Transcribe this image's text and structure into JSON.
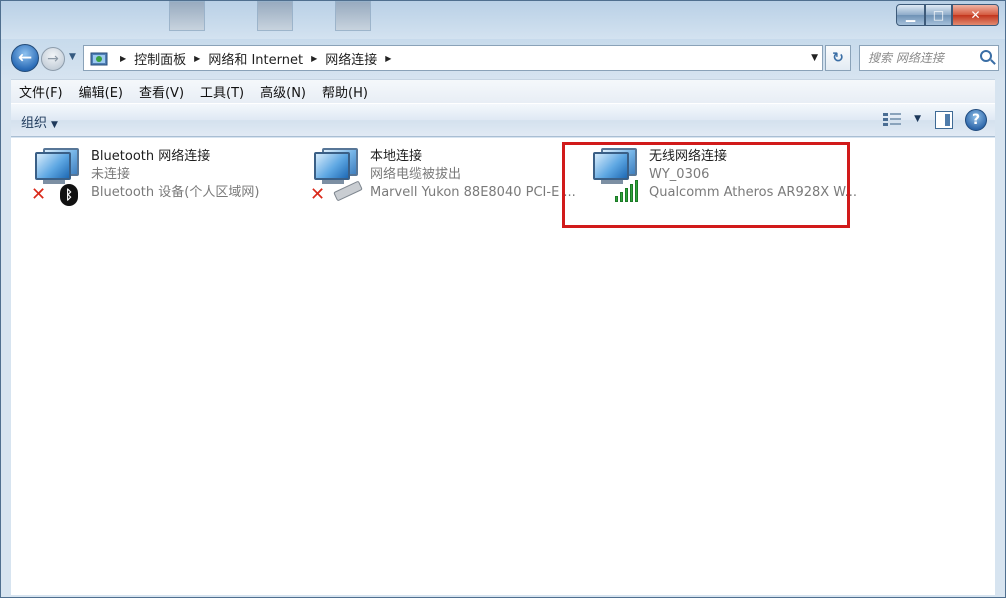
{
  "window": {
    "controls": {
      "minimize": "▁",
      "maximize": "□",
      "close": "✕"
    }
  },
  "address": {
    "breadcrumbs": [
      "控制面板",
      "网络和 Internet",
      "网络连接"
    ],
    "search_placeholder": "搜索 网络连接"
  },
  "menubar": {
    "items": [
      "文件(F)",
      "编辑(E)",
      "查看(V)",
      "工具(T)",
      "高级(N)",
      "帮助(H)"
    ]
  },
  "toolbar": {
    "organize_label": "组织",
    "help_label": "?"
  },
  "connections": [
    {
      "name": "Bluetooth 网络连接",
      "status": "未连接",
      "device": "Bluetooth 设备(个人区域网)",
      "badge": "bluetooth-icon",
      "disconnected": true
    },
    {
      "name": "本地连接",
      "status": "网络电缆被拔出",
      "device": "Marvell Yukon 88E8040 PCI-E ...",
      "badge": "ethernet-cable-icon",
      "disconnected": true
    },
    {
      "name": "无线网络连接",
      "status": "WY_0306",
      "device": "Qualcomm Atheros AR928X W...",
      "badge": "signal-strength-icon",
      "disconnected": false
    }
  ],
  "colors": {
    "highlight_border": "#d11a1a",
    "signal_green": "#2fa43a",
    "error_red": "#d9291a"
  }
}
